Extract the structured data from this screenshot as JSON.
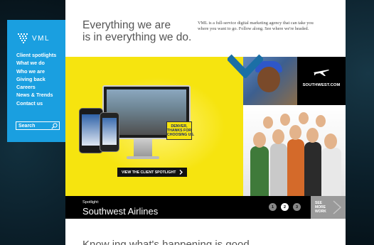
{
  "brand": {
    "logo_text": "VML",
    "accent": "#1a9fe0",
    "hero_yellow": "#f6e40f",
    "chevron_color": "#1b6fa6"
  },
  "nav": {
    "items": [
      {
        "label": "Client spotlights"
      },
      {
        "label": "What we do"
      },
      {
        "label": "Who we are"
      },
      {
        "label": "Giving back"
      },
      {
        "label": "Careers"
      },
      {
        "label": "News & Trends"
      },
      {
        "label": "Contact us"
      }
    ],
    "search_placeholder": "Search",
    "search_icon": "magnifier-icon"
  },
  "header": {
    "headline_line1": "Everything we are",
    "headline_line2": "is in everything we do.",
    "intro": "VML is a full-service digital marketing agency that can take you where you want to go. Follow along. See where we're headed."
  },
  "hero": {
    "sign_text": "DENVER,\nTHANKS FOR\nCHOOSING US.",
    "button_label": "VIEW THE CLIENT SPOTLIGHT",
    "client_logo_text": "SOUTHWEST.COM"
  },
  "caption": {
    "label": "Spotlight:",
    "title": "Southwest Airlines",
    "pages": [
      "1",
      "2",
      "3"
    ],
    "active_page": "2",
    "see_more": "SEE\nMORE\nWORK"
  },
  "teaser": {
    "text": "Know ing what's happening is good"
  }
}
